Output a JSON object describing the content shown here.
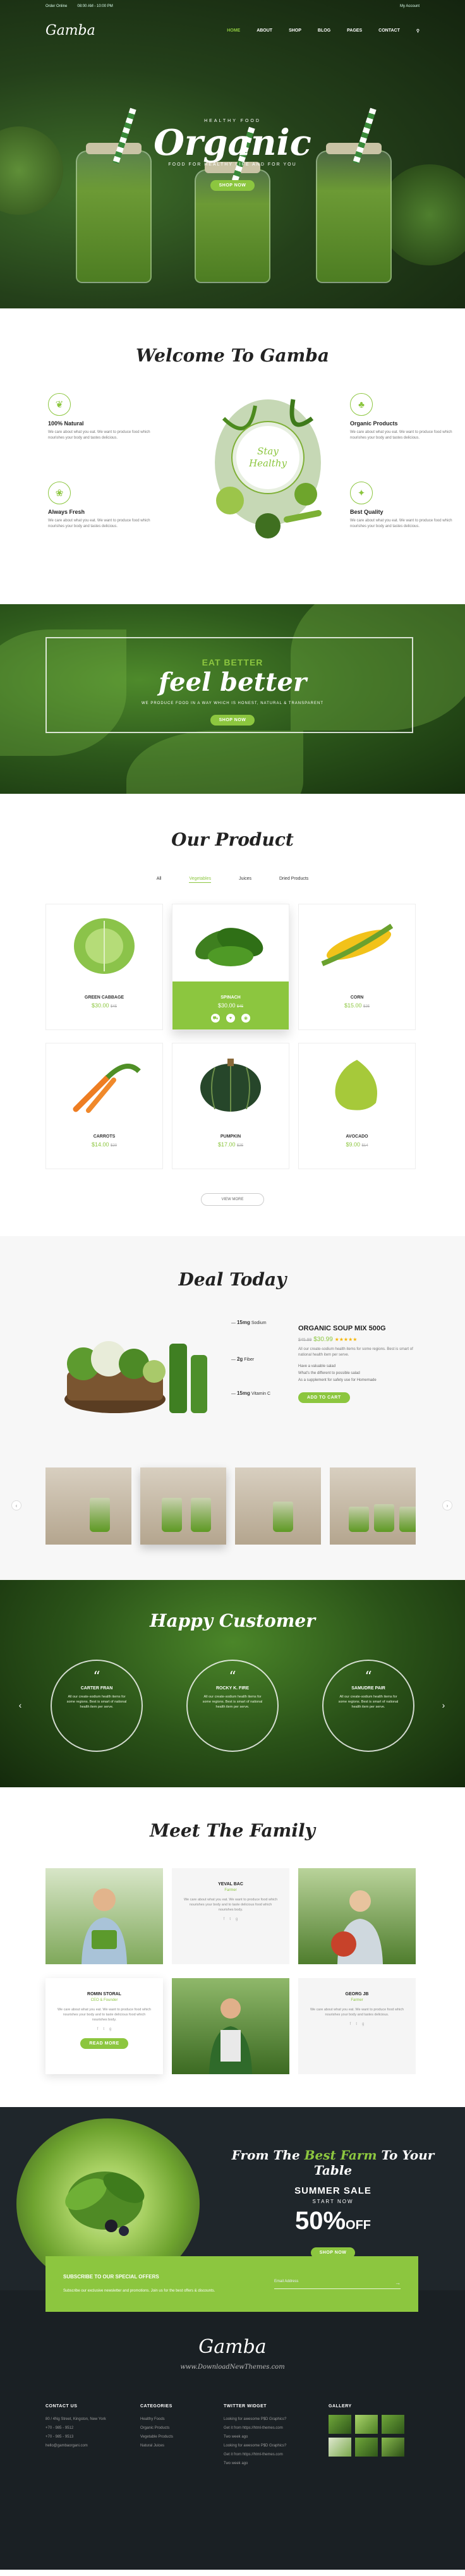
{
  "topbar": {
    "order": "Order Online",
    "hours": "08:00 AM - 10:00 PM",
    "account": "My Account"
  },
  "logo": "Gamba",
  "nav": [
    "HOME",
    "ABOUT",
    "SHOP",
    "BLOG",
    "PAGES",
    "CONTACT"
  ],
  "hero": {
    "sub": "HEALTHY FOOD",
    "title": "Organic",
    "tag": "FOOD FOR HEALTHY LIFE AND FOR YOU",
    "button": "SHOP NOW"
  },
  "welcome": {
    "title": "Welcome To Gamba",
    "badge_line1": "Stay",
    "badge_line2": "Healthy",
    "features": [
      {
        "title": "100% Natural",
        "text": "We care about what you eat. We want to produce food which nourishes your body and tastes delicious."
      },
      {
        "title": "Organic Products",
        "text": "We care about what you eat. We want to produce food which nourishes your body and tastes delicious."
      },
      {
        "title": "Always Fresh",
        "text": "We care about what you eat. We want to produce food which nourishes your body and tastes delicious."
      },
      {
        "title": "Best Quality",
        "text": "We care about what you eat. We want to produce food which nourishes your body and tastes delicious."
      }
    ]
  },
  "banner": {
    "eyebrow": "EAT BETTER",
    "title": "feel better",
    "text": "WE PRODUCE FOOD IN A WAY WHICH IS HONEST, NATURAL & TRANSPARENT",
    "button": "SHOP NOW"
  },
  "products": {
    "title": "Our Product",
    "tabs": [
      "All",
      "Vegetables",
      "Juices",
      "Dried Products"
    ],
    "items": [
      {
        "name": "GREEN CABBAGE",
        "price": "$30.00",
        "old": "$45"
      },
      {
        "name": "SPINACH",
        "price": "$30.00",
        "old": "$45"
      },
      {
        "name": "CORN",
        "price": "$15.00",
        "old": "$25"
      },
      {
        "name": "CARROTS",
        "price": "$14.00",
        "old": "$20"
      },
      {
        "name": "PUMPKIN",
        "price": "$17.00",
        "old": "$25"
      },
      {
        "name": "AVOCADO",
        "price": "$9.00",
        "old": "$14"
      }
    ],
    "view_more": "VIEW MORE"
  },
  "deal": {
    "title": "Deal Today",
    "labels": [
      {
        "n": "15mg",
        "t": "Sodium"
      },
      {
        "n": "2g",
        "t": "Fiber"
      },
      {
        "n": "15mg",
        "t": "Vitamin C"
      }
    ],
    "product": "ORGANIC SOUP MIX 500G",
    "price": "$30.99",
    "old": "$45.99",
    "stars": "★★★★★",
    "desc": "All our create-sodium health items for some regions. Best is smart of national health item per serve.",
    "list": [
      "Have a valuable salad",
      "What's the different to possible salad",
      "As a supplement for safety use for Homemade"
    ],
    "button": "ADD TO CART"
  },
  "testimonials": {
    "title": "Happy Customer",
    "items": [
      {
        "name": "CARTER FRAN",
        "text": "All our create-sodium health items for some regions. Best is smart of national health item per serve."
      },
      {
        "name": "ROCKY K. FIRE",
        "text": "All our create-sodium health items for some regions. Best is smart of national health item per serve."
      },
      {
        "name": "SAMUDRE PAIR",
        "text": "All our create-sodium health items for some regions. Best is smart of national health item per serve."
      }
    ]
  },
  "team": {
    "title": "Meet The Family",
    "members": [
      {
        "name": "YEVAL BAC",
        "role": "Farmer",
        "text": "We care about what you eat. We want to produce food which nourishes your body and to taste delicious food which nourishes body."
      },
      {
        "name": "ROMIN STORAL",
        "role": "CEO & Founder",
        "text": "We care about what you eat. We want to produce food which nourishes your body and to taste delicious food which nourishes body.",
        "button": "READ MORE"
      },
      {
        "name": "GEORG JB",
        "role": "Farmer",
        "text": "We care about what you eat. We want to produce food which nourishes your body and tastes delicious."
      }
    ]
  },
  "sale": {
    "from": "From The",
    "best": "Best Farm",
    "to": "To Your Table",
    "title": "SUMMER SALE",
    "start": "START NOW",
    "percent": "50%",
    "off": "OFF",
    "button": "SHOP NOW"
  },
  "subscribe": {
    "title": "SUBSCRIBE TO OUR SPECIAL OFFERS",
    "text": "Subscribe our exclusive newsletter and promotions. Join us for the best offers & discounts.",
    "placeholder": "Email Address",
    "arrow": "→"
  },
  "footer": {
    "logo": "Gamba",
    "site": "www.DownloadNewThemes.com",
    "cols": [
      {
        "title": "CONTACT US",
        "items": [
          "80 / 4Ng Street, Kingston, New York",
          "+70 - 985 - 9512",
          "+70 - 985 - 9513",
          "hello@gambaorgani.com"
        ]
      },
      {
        "title": "CATEGORIES",
        "items": [
          "Healthy Foods",
          "Organic Products",
          "Vegetable Products",
          "Natural Juices"
        ]
      },
      {
        "title": "TWITTER WIDGET",
        "items": [
          "Looking for awesome P$D Graphics?",
          "Get it from https://html-themes.com",
          "Two week ago",
          "Looking for awesome P$D Graphics?",
          "Get it from https://html-themes.com",
          "Two week ago"
        ]
      },
      {
        "title": "GALLERY",
        "items": []
      }
    ]
  },
  "colors": {
    "accent": "#8cc63f",
    "dark": "#1a2024"
  }
}
